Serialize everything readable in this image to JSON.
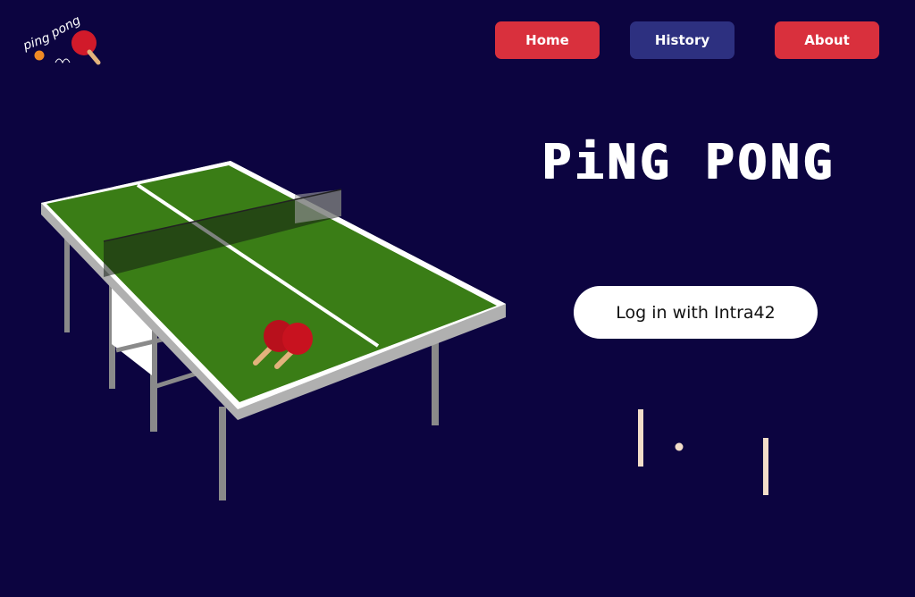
{
  "brand": {
    "logo_text_1": "ping",
    "logo_text_2": "pong"
  },
  "nav": {
    "home_label": "Home",
    "history_label": "History",
    "about_label": "About"
  },
  "hero": {
    "title": "PiNG PONG",
    "login_label": "Log in with Intra42"
  },
  "colors": {
    "background": "#0c0440",
    "nav_red": "#d9303d",
    "nav_blue": "#2d3080",
    "table_green": "#3a7d16",
    "paddle_red": "#b8101c",
    "paddle_handle": "#e2b27c"
  },
  "icons": {
    "logo": "ping-pong-logo-icon",
    "table": "ping-pong-table-illustration",
    "pong": "pong-game-animation"
  }
}
